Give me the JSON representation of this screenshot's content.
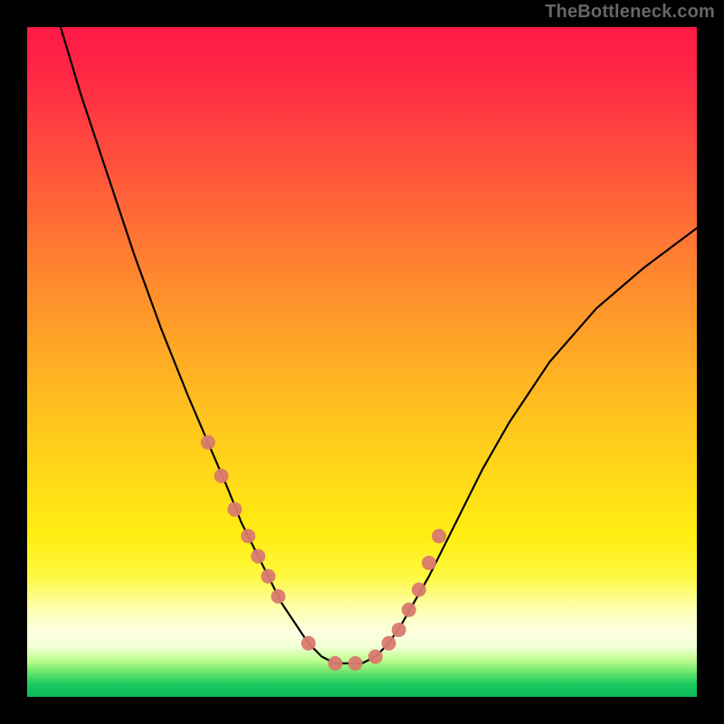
{
  "watermark": "TheBottleneck.com",
  "chart_data": {
    "type": "line",
    "title": "",
    "xlabel": "",
    "ylabel": "",
    "xlim": [
      0,
      100
    ],
    "ylim": [
      0,
      100
    ],
    "series": [
      {
        "name": "curve",
        "x": [
          5,
          8,
          12,
          16,
          20,
          24,
          27,
          30,
          32,
          34,
          36,
          38,
          40,
          42,
          44,
          46,
          48,
          50,
          52,
          54,
          56,
          60,
          64,
          68,
          72,
          78,
          85,
          92,
          100
        ],
        "y": [
          100,
          90,
          78,
          66,
          55,
          45,
          38,
          31,
          26,
          22,
          18,
          14,
          11,
          8,
          6,
          5,
          5,
          5,
          6,
          8,
          11,
          18,
          26,
          34,
          41,
          50,
          58,
          64,
          70
        ]
      }
    ],
    "markers": {
      "name": "highlighted-points",
      "x": [
        27,
        29,
        31,
        33,
        34.5,
        36,
        37.5,
        42,
        46,
        49,
        52,
        54,
        55.5,
        57,
        58.5,
        60,
        61.5
      ],
      "y": [
        38,
        33,
        28,
        24,
        21,
        18,
        15,
        8,
        5,
        5,
        6,
        8,
        10,
        13,
        16,
        20,
        24
      ]
    }
  }
}
